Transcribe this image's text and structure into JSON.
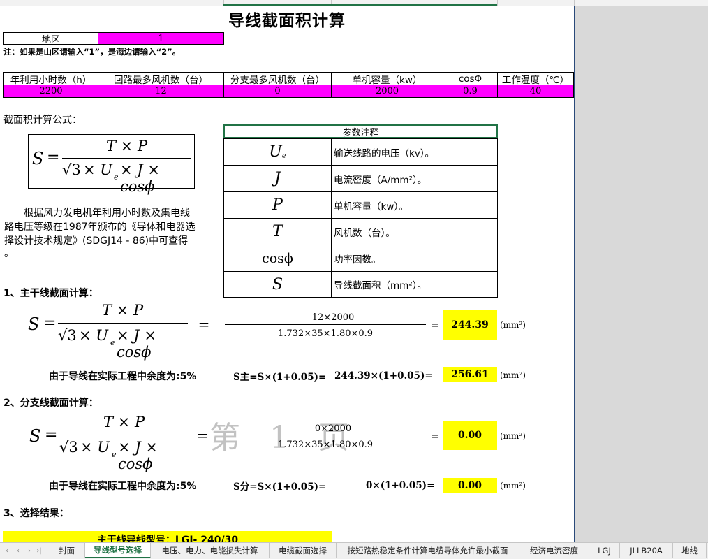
{
  "title": "导线截面积计算",
  "region": {
    "label": "地区",
    "value": "1",
    "note": "注：如果是山区请输入“1”，是海边请输入“2”。"
  },
  "params": {
    "headers": [
      "年利用小时数（h）",
      "回路最多风机数（台）",
      "分支最多风机数（台）",
      "单机容量（kw）",
      "cosΦ",
      "工作温度（℃）"
    ],
    "values": [
      "2200",
      "12",
      "0",
      "2000",
      "0.9",
      "40"
    ]
  },
  "formula_section": {
    "label": "截面积计算公式：",
    "formula": {
      "S": "S",
      "eq": "=",
      "num": "T × P",
      "den_sqrt": "√3",
      "den_rest": "× U",
      "den_sub": "e",
      "den_tail": "× J × cosϕ"
    },
    "description": "根据风力发电机年利用小时数及集电线路电压等级在1987年颁布的《导体和电器选择设计技术规定》(SDGJ14 - 86)中可查得。",
    "desc_lines": [
      "　　根据风力发电机年利用小时数及集电线",
      "路电压等级在1987年颁布的《导体和电器选",
      "择设计技术规定》(SDGJ14 - 86)中可查得",
      "。"
    ]
  },
  "legend": {
    "header": "参数注释",
    "rows": [
      {
        "symbol": "U",
        "sub": "e",
        "desc": "输送线路的电压（kv）。"
      },
      {
        "symbol": "J",
        "desc": "电流密度（A/mm²）。"
      },
      {
        "symbol": "P",
        "desc": "单机容量（kw）。"
      },
      {
        "symbol": "T",
        "desc": "风机数（台）。"
      },
      {
        "symbol": "cosϕ",
        "desc": "功率因数。"
      },
      {
        "symbol": "S",
        "desc": "导线截面积（mm²）。"
      }
    ]
  },
  "main_calc": {
    "heading": "1、主干线截面计算：",
    "numerator": "12×2000",
    "denominator": "1.732×35×1.80×0.9",
    "eq": "=",
    "result": "244.39",
    "unit": "(mm²)",
    "margin_label": "由于导线在实际工程中余度为:5%",
    "margin_formula": "S主=S×(1+0.05)=",
    "margin_expr": "244.39×(1+0.05)=",
    "margin_result": "256.61",
    "margin_unit": "(mm²)"
  },
  "branch_calc": {
    "heading": "2、分支线截面计算：",
    "numerator": "0×2000",
    "denominator": "1.732×35×1.80×0.9",
    "eq": "=",
    "result": "0.00",
    "unit": "(mm²)",
    "margin_label": "由于导线在实际工程中余度为:5%",
    "margin_formula": "S分=S×(1+0.05)=",
    "margin_expr": "0×(1+0.05)=",
    "margin_result": "0.00",
    "margin_unit": "(mm²)"
  },
  "watermark": "第 1 页",
  "selection": {
    "heading": "3、选择结果：",
    "main_type": "主干线导线型号：LGJ- 240/30"
  },
  "tabs": [
    "封面",
    "导线型号选择",
    "电压、电力、电能损失计算",
    "电缆截面选择",
    "按短路热稳定条件计算电缆导体允许最小截面",
    "经济电流密度",
    "LGJ",
    "JLLB20A",
    "地线"
  ],
  "active_tab": "导线型号选择",
  "colors": {
    "input_bg": "#ff00ff",
    "result_bg": "#ffff00",
    "active_tab": "#217346"
  }
}
